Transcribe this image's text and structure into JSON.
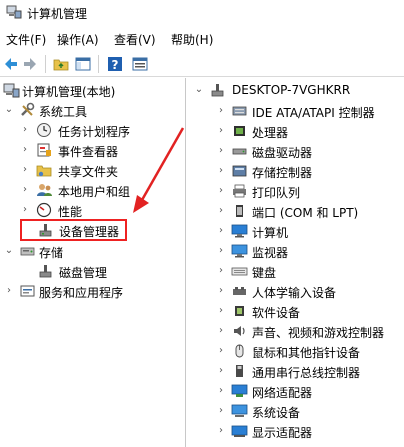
{
  "window": {
    "title": "计算机管理"
  },
  "menu": [
    {
      "label": "文件(F)"
    },
    {
      "label": "操作(A)"
    },
    {
      "label": "查看(V)"
    },
    {
      "label": "帮助(H)"
    }
  ],
  "toolbar": [
    "back-arrow-icon",
    "forward-arrow-icon",
    "up-folder-icon",
    "show-hide-tree-icon",
    "help-icon",
    "properties-icon"
  ],
  "left_tree": {
    "root": "计算机管理(本地)",
    "system_tools": "系统工具",
    "task_scheduler": "任务计划程序",
    "event_viewer": "事件查看器",
    "shared_folders": "共享文件夹",
    "local_users": "本地用户和组",
    "performance": "性能",
    "device_manager": "设备管理器",
    "storage": "存储",
    "disk_management": "磁盘管理",
    "services_apps": "服务和应用程序"
  },
  "right_tree": {
    "root": "DESKTOP-7VGHKRR",
    "items": [
      {
        "label": "IDE ATA/ATAPI 控制器",
        "icon": "ide-controller-icon"
      },
      {
        "label": "处理器",
        "icon": "processor-icon"
      },
      {
        "label": "磁盘驱动器",
        "icon": "disk-drive-icon"
      },
      {
        "label": "存储控制器",
        "icon": "storage-controller-icon"
      },
      {
        "label": "打印队列",
        "icon": "printer-icon"
      },
      {
        "label": "端口 (COM 和 LPT)",
        "icon": "port-icon"
      },
      {
        "label": "计算机",
        "icon": "computer-icon"
      },
      {
        "label": "监视器",
        "icon": "monitor-icon"
      },
      {
        "label": "键盘",
        "icon": "keyboard-icon"
      },
      {
        "label": "人体学输入设备",
        "icon": "hid-icon"
      },
      {
        "label": "软件设备",
        "icon": "software-device-icon"
      },
      {
        "label": "声音、视频和游戏控制器",
        "icon": "sound-icon"
      },
      {
        "label": "鼠标和其他指针设备",
        "icon": "mouse-icon"
      },
      {
        "label": "通用串行总线控制器",
        "icon": "usb-icon"
      },
      {
        "label": "网络适配器",
        "icon": "network-adapter-icon"
      },
      {
        "label": "系统设备",
        "icon": "system-device-icon"
      },
      {
        "label": "显示适配器",
        "icon": "display-adapter-icon"
      }
    ]
  },
  "colors": {
    "annotation": "#e22222",
    "accent": "#2a7fd4"
  }
}
